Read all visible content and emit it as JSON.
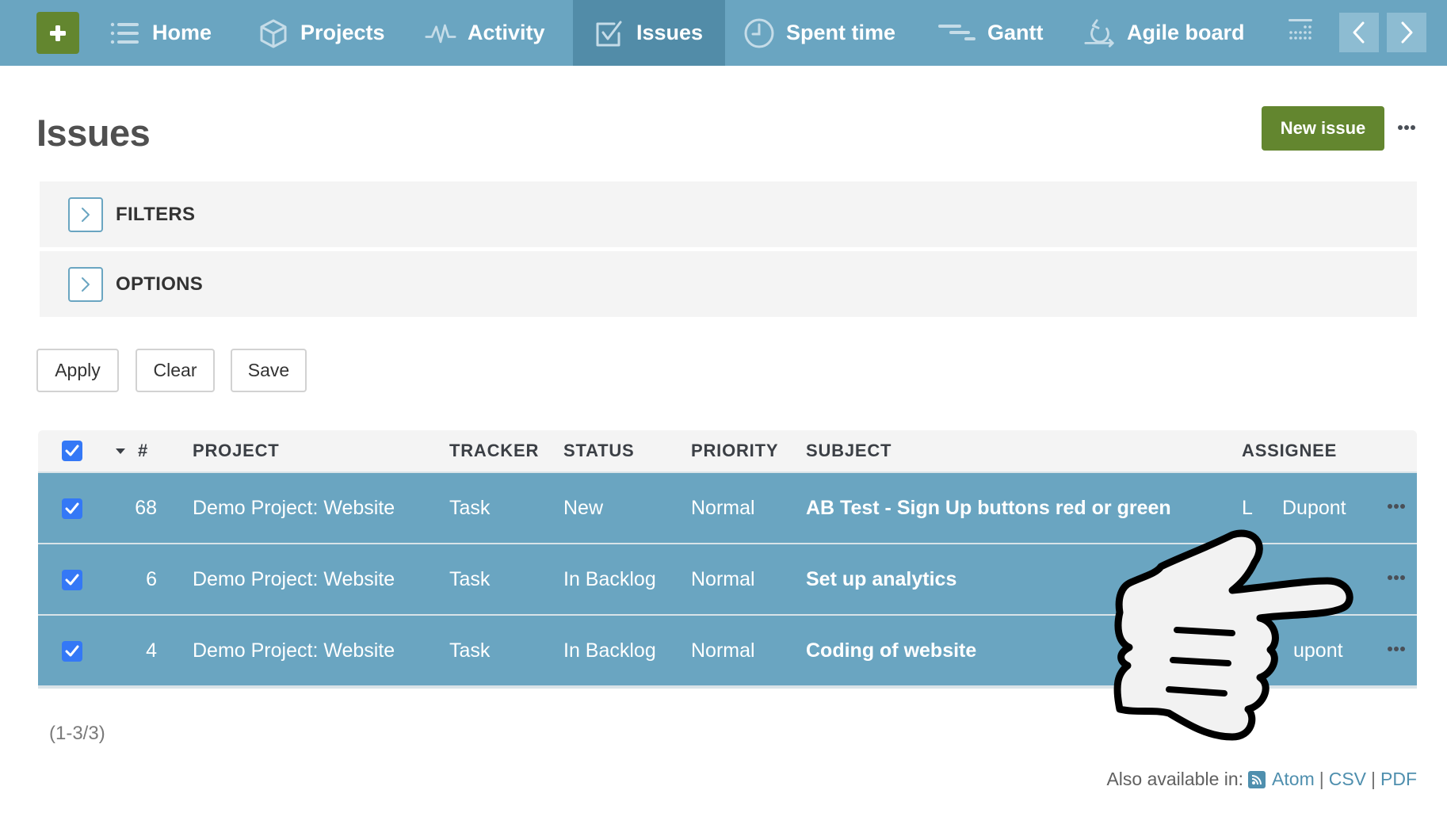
{
  "nav": {
    "add_button_label": "+",
    "items": [
      {
        "label": "Home",
        "icon": "list-icon"
      },
      {
        "label": "Projects",
        "icon": "cube-icon"
      },
      {
        "label": "Activity",
        "icon": "pulse-icon"
      },
      {
        "label": "Issues",
        "icon": "checkbox-icon",
        "active": true
      },
      {
        "label": "Spent time",
        "icon": "clock-icon"
      },
      {
        "label": "Gantt",
        "icon": "gantt-icon"
      },
      {
        "label": "Agile board",
        "icon": "agile-cycle-icon"
      }
    ],
    "more_icon": "grid-more-icon",
    "prev_icon": "chevron-left-icon",
    "next_icon": "chevron-right-icon"
  },
  "page": {
    "title": "Issues",
    "new_issue_label": "New issue",
    "more_icon": "ellipsis-icon"
  },
  "panels": {
    "filters_label": "FILTERS",
    "options_label": "OPTIONS"
  },
  "actions": {
    "apply": "Apply",
    "clear": "Clear",
    "save": "Save"
  },
  "table": {
    "headers": {
      "id": "#",
      "project": "PROJECT",
      "tracker": "TRACKER",
      "status": "STATUS",
      "priority": "PRIORITY",
      "subject": "SUBJECT",
      "assignee": "ASSIGNEE"
    },
    "select_all_checked": true,
    "sort_direction": "descending",
    "rows": [
      {
        "id": "68",
        "project": "Demo Project: Website",
        "tracker": "Task",
        "status": "New",
        "priority": "Normal",
        "subject": "AB Test - Sign Up buttons red or green",
        "assignee_visible_prefix": "L",
        "assignee_visible": "Dupont",
        "checked": true
      },
      {
        "id": "6",
        "project": "Demo Project: Website",
        "tracker": "Task",
        "status": "In Backlog",
        "priority": "Normal",
        "subject": "Set up analytics",
        "assignee_visible_prefix": "",
        "assignee_visible": "",
        "checked": true
      },
      {
        "id": "4",
        "project": "Demo Project: Website",
        "tracker": "Task",
        "status": "In Backlog",
        "priority": "Normal",
        "subject": "Coding of website",
        "assignee_visible_prefix": "",
        "assignee_visible": "upont",
        "checked": true
      }
    ],
    "row_color": "#6aa5c1"
  },
  "footer": {
    "count": "(1-3/3)",
    "also_available": "Also available in:",
    "formats": [
      "Atom",
      "CSV",
      "PDF"
    ],
    "separator": "|"
  },
  "colors": {
    "nav_bg": "#6aa5c1",
    "nav_active": "#528ca8",
    "accent_green": "#63862f",
    "link_blue": "#4f8fae",
    "checkbox_blue": "#3478f6"
  },
  "overlay": {
    "pointer": "pointing-hand-cursor"
  }
}
